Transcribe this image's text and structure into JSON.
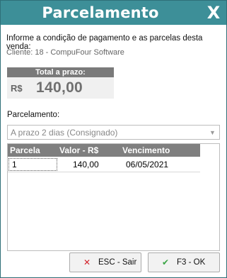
{
  "window": {
    "title": "Parcelamento",
    "close_label": "X"
  },
  "info": {
    "message": "Informe a condição de pagamento e as parcelas desta venda:",
    "client": "Cliente: 18 - CompuFour Software"
  },
  "total": {
    "label": "Total a prazo:",
    "currency": "R$",
    "value": "140,00"
  },
  "parcelamento": {
    "label": "Parcelamento:",
    "selected": "A prazo 2 dias (Consignado)"
  },
  "grid": {
    "columns": [
      "Parcela",
      "Valor - R$",
      "Vencimento"
    ],
    "rows": [
      {
        "parcela": "1",
        "valor": "140,00",
        "vencimento": "06/05/2021"
      }
    ]
  },
  "buttons": {
    "esc_label": "ESC - Sair",
    "ok_label": "F3 - OK"
  },
  "colors": {
    "titlebar": "#3d8f98",
    "header": "#7f7f7f"
  },
  "icons": {
    "esc": "x-icon",
    "ok": "check-icon"
  }
}
